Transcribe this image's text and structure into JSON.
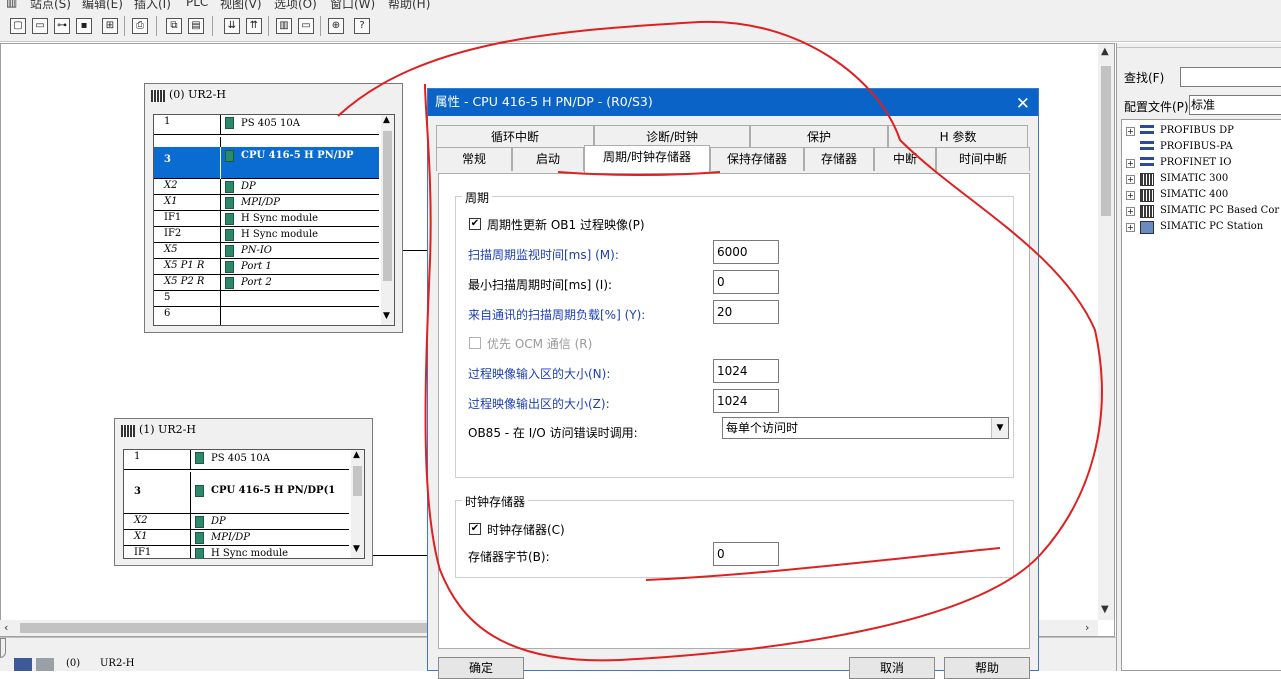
{
  "menubar": {
    "items": [
      "站点(S)",
      "编辑(E)",
      "插入(I)",
      "PLC",
      "视图(V)",
      "选项(O)",
      "窗口(W)",
      "帮助(H)"
    ]
  },
  "toolbar": {
    "icons": [
      "new-icon",
      "open-icon",
      "network-icon",
      "save-icon",
      "compile-icon",
      "print-icon",
      "copy-icon",
      "paste-icon",
      "download-icon",
      "upload-icon",
      "catalog-icon",
      "display-icon",
      "netpro-icon",
      "help-icon"
    ]
  },
  "rack0": {
    "title": "(0) UR2-H",
    "rows": [
      {
        "slot": "1",
        "module": "PS 405 10A"
      },
      {
        "slot": "3",
        "module": "CPU 416-5 H PN/DP"
      },
      {
        "slot": "X2",
        "module": "DP"
      },
      {
        "slot": "X1",
        "module": "MPI/DP"
      },
      {
        "slot": "IF1",
        "module": "H Sync module"
      },
      {
        "slot": "IF2",
        "module": "H Sync module"
      },
      {
        "slot": "X5",
        "module": "PN-IO"
      },
      {
        "slot": "X5 P1 R",
        "module": "Port 1"
      },
      {
        "slot": "X5 P2 R",
        "module": "Port 2"
      },
      {
        "slot": "5",
        "module": ""
      },
      {
        "slot": "6",
        "module": ""
      }
    ]
  },
  "rack1": {
    "title": "(1) UR2-H",
    "rows": [
      {
        "slot": "1",
        "module": "PS 405 10A"
      },
      {
        "slot": "3",
        "module": "CPU 416-5 H PN/DP(1"
      },
      {
        "slot": "X2",
        "module": "DP"
      },
      {
        "slot": "X1",
        "module": "MPI/DP"
      },
      {
        "slot": "IF1",
        "module": "H Sync module"
      }
    ]
  },
  "dialog": {
    "title": "属性 - CPU 416-5 H PN/DP - (R0/S3)",
    "tabs_row1": [
      "循环中断",
      "诊断/时钟",
      "保护",
      "H 参数"
    ],
    "tabs_row2": [
      "常规",
      "启动",
      "周期/时钟存储器",
      "保持存储器",
      "存储器",
      "中断",
      "时间中断"
    ],
    "cycle_group": {
      "title": "周期",
      "cyclic_update_label": "周期性更新 OB1 过程映像(P)",
      "cyclic_update_checked": true,
      "scan_monitor_label": "扫描周期监视时间[ms] (M):",
      "scan_monitor_value": "6000",
      "min_scan_label": "最小扫描周期时间[ms] (I):",
      "min_scan_value": "0",
      "comm_load_label": "来自通讯的扫描周期负载[%] (Y):",
      "comm_load_value": "20",
      "ocm_label": "优先 OCM 通信 (R)",
      "ocm_checked": false,
      "pi_input_label": "过程映像输入区的大小(N):",
      "pi_input_value": "1024",
      "pi_output_label": "过程映像输出区的大小(Z):",
      "pi_output_value": "1024",
      "ob85_label": "OB85 - 在 I/O 访问错误时调用:",
      "ob85_value": "每单个访问时"
    },
    "clock_group": {
      "title": "时钟存储器",
      "clock_memory_label": "时钟存储器(C)",
      "clock_memory_checked": true,
      "memory_byte_label": "存储器字节(B):",
      "memory_byte_value": "0"
    },
    "buttons": {
      "ok": "确定",
      "cancel": "取消",
      "help": "帮助"
    }
  },
  "catalog": {
    "find_label": "查找(F)",
    "profile_label": "配置文件(P)",
    "profile_value": "标准",
    "tree": [
      {
        "label": "PROFIBUS DP",
        "expander": "+"
      },
      {
        "label": "PROFIBUS-PA",
        "expander": ""
      },
      {
        "label": "PROFINET IO",
        "expander": "+"
      },
      {
        "label": "SIMATIC 300",
        "expander": "+"
      },
      {
        "label": "SIMATIC 400",
        "expander": "+"
      },
      {
        "label": "SIMATIC PC Based Cor",
        "expander": "+"
      },
      {
        "label": "SIMATIC PC Station",
        "expander": "+"
      }
    ]
  },
  "statusbar": {
    "rack_ref": "(0)",
    "rack_name": "UR2-H"
  },
  "colors": {
    "title_blue": "#0a64c8",
    "selection_blue": "#0a6cd0",
    "link_blue": "#1c3fb8",
    "annotation_red": "#e02020"
  }
}
